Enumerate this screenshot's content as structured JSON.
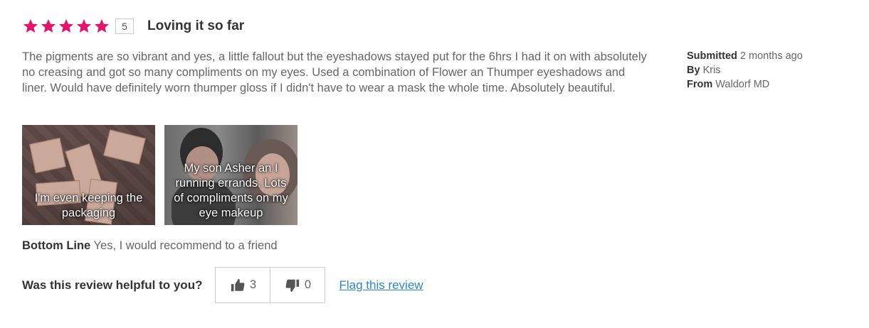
{
  "review": {
    "rating": 5,
    "rating_label": "5",
    "star_color": "#e0156b",
    "title": "Loving it so far",
    "body": "The pigments are so vibrant and yes, a little fallout but the eyeshadows stayed put for the 6hrs I had it on with absolutely no creasing and got so many compliments on my eyes. Used a combination of Flower an Thumper eyeshadows and liner. Would have definitely worn thumper gloss if I didn't have to wear a mask the whole time. Absolutely beautiful.",
    "photos": [
      {
        "caption": "I'm even keeping the packaging"
      },
      {
        "caption": "My son Asher an I running errands. Lots of compliments on my eye makeup"
      }
    ],
    "bottom_line_label": "Bottom Line",
    "bottom_line_value": "Yes, I would recommend to a friend"
  },
  "helpful": {
    "question": "Was this review helpful to you?",
    "up_count": "3",
    "down_count": "0",
    "flag_label": "Flag this review",
    "link_color": "#2a86c8"
  },
  "meta": {
    "submitted_label": "Submitted",
    "submitted_value": "2 months ago",
    "by_label": "By",
    "by_value": "Kris",
    "from_label": "From",
    "from_value": "Waldorf MD"
  }
}
